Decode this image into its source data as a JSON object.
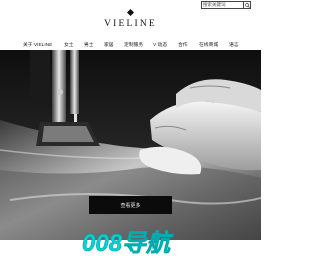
{
  "search": {
    "placeholder": "搜索关键词",
    "button_icon": "search-icon"
  },
  "logo": {
    "text": "VIELINE",
    "mark_icon": "diamond-logo-mark"
  },
  "nav": {
    "items": [
      {
        "label": "关于 VIELINE"
      },
      {
        "label": "女士"
      },
      {
        "label": "男士"
      },
      {
        "label": "家居"
      },
      {
        "label": "定制服务"
      },
      {
        "label": "V 动态"
      },
      {
        "label": "合作"
      },
      {
        "label": "在线商城"
      },
      {
        "label": "语言"
      }
    ]
  },
  "hero": {
    "cta_label": "查看更多",
    "image_subject": "sewing-machine-leather-photo"
  },
  "watermark": {
    "text": "008导航"
  },
  "colors": {
    "accent": "#00d2d4",
    "text": "#222222",
    "button_bg": "#0b0b0b"
  }
}
